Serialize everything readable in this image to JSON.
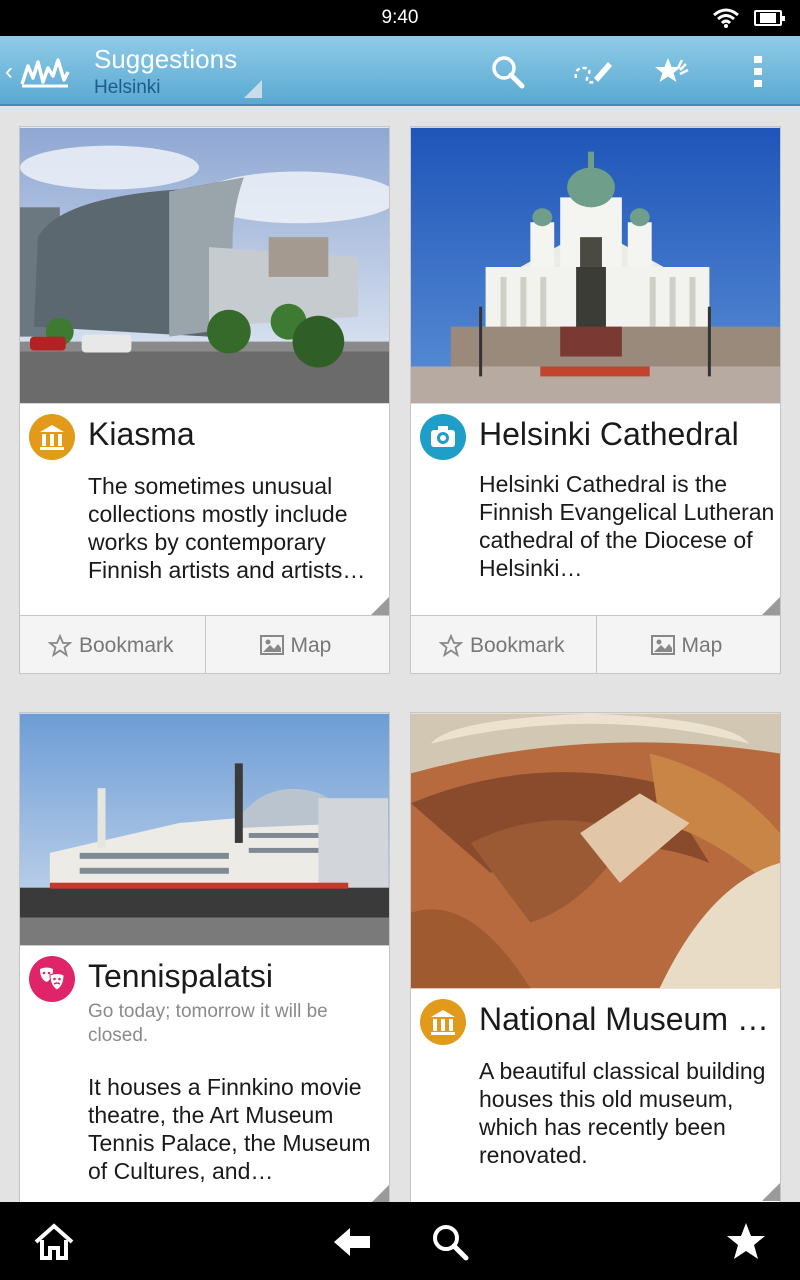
{
  "status": {
    "time": "9:40"
  },
  "action_bar": {
    "title": "Suggestions",
    "subtitle": "Helsinki",
    "icons": [
      "app-logo-icon",
      "search-icon",
      "itinerary-icon",
      "favorites-icon",
      "overflow-menu-icon"
    ]
  },
  "cards": [
    {
      "title": "Kiasma",
      "category_icon": "museum-icon",
      "icon_color": "#e29a1a",
      "note": "",
      "description": "The sometimes unusual collections mostly include works by contemporary Finnish artists and artists…",
      "bookmark_label": "Bookmark",
      "map_label": "Map"
    },
    {
      "title": "Helsinki Cathedral",
      "category_icon": "camera-icon",
      "icon_color": "#1f9fc7",
      "note": "",
      "description": "Helsinki Cathedral is the Finnish Evangelical Lutheran cathedral of the Diocese of Helsinki…",
      "bookmark_label": "Bookmark",
      "map_label": "Map"
    },
    {
      "title": "Tennispalatsi",
      "category_icon": "theater-masks-icon",
      "icon_color": "#e0246a",
      "note": "Go today; tomorrow it will be closed.",
      "description": "It houses a Finnkino movie theatre, the Art Museum Tennis Palace, the Museum of Cultures, and…"
    },
    {
      "title": "National Museum …",
      "category_icon": "museum-icon",
      "icon_color": "#e29a1a",
      "note": "",
      "description": "A beautiful classical building houses this old museum, which has recently been renovated."
    }
  ],
  "bottom_bar": {
    "icons": [
      "home-icon",
      "back-icon",
      "search-icon",
      "favorites-icon"
    ]
  }
}
